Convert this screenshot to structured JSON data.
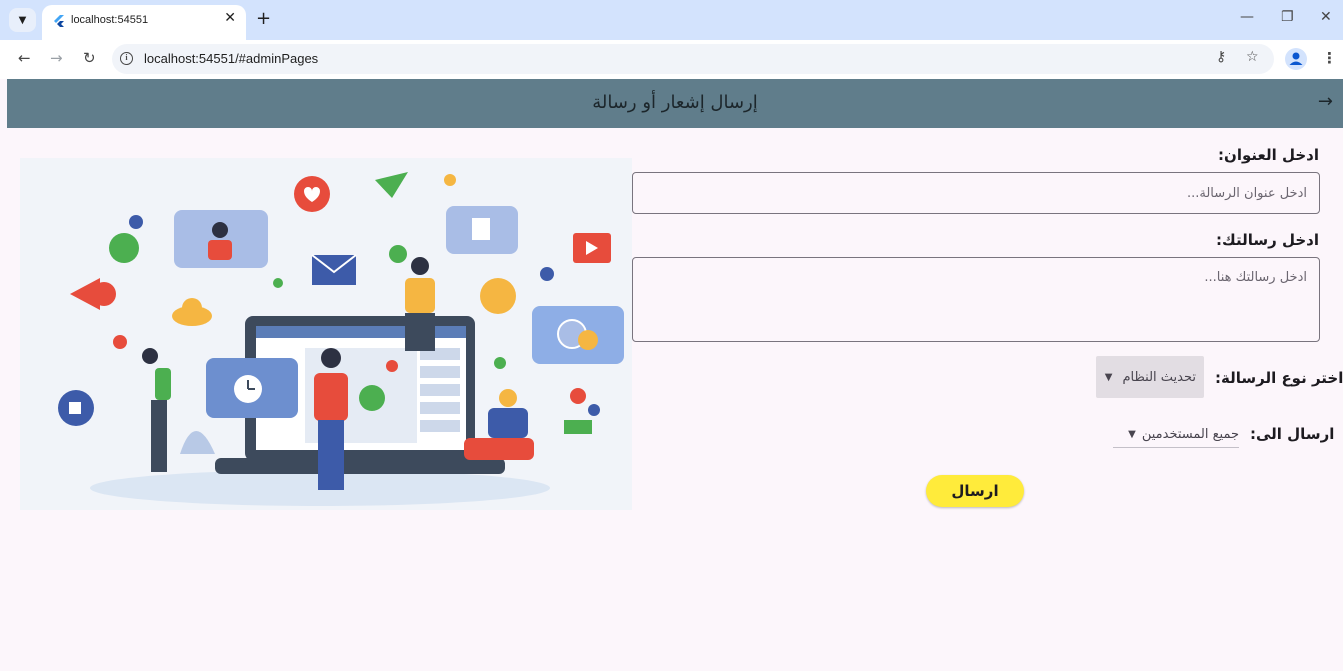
{
  "browser": {
    "tab_title": "localhost:54551",
    "url": "localhost:54551/#adminPages",
    "new_tab_symbol": "+",
    "close_symbol": "✕"
  },
  "appbar": {
    "title": "إرسال إشعار أو رسالة",
    "back_icon": "arrow-right-icon"
  },
  "form": {
    "title_label": "ادخل العنوان:",
    "title_placeholder": "ادخل عنوان الرسالة...",
    "title_value": "",
    "message_label": "ادخل رسالتك:",
    "message_placeholder": "ادخل رسالتك هنا...",
    "message_value": "",
    "type_label": "اختر نوع الرسالة:",
    "type_selected": "تحديث النظام",
    "recipient_label": "ارسال الى:",
    "recipient_selected": "جميع المستخدمين",
    "send_label": "ارسال"
  },
  "colors": {
    "appbar": "#607d8b",
    "send_button": "#ffeb3b",
    "page_bg": "#fcf6fb"
  }
}
